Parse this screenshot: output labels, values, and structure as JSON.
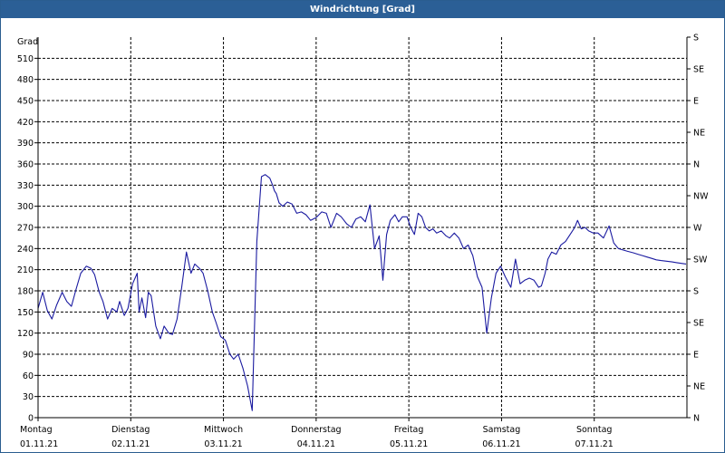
{
  "window": {
    "title": "Windrichtung [Grad]"
  },
  "colors": {
    "title_bar": "#2b5f96",
    "line": "#1a1aa0",
    "grid": "#000000",
    "axis": "#000000"
  },
  "chart_data": {
    "type": "line",
    "title": "Windrichtung [Grad]",
    "ylabel": "Grad",
    "ylim": [
      0,
      540
    ],
    "y_ticks": [
      0,
      30,
      60,
      90,
      120,
      150,
      180,
      210,
      240,
      270,
      300,
      330,
      360,
      390,
      420,
      450,
      480,
      510
    ],
    "right_axis_labels": [
      "N",
      "NE",
      "E",
      "SE",
      "S",
      "SW",
      "W",
      "NW",
      "N",
      "NE",
      "E",
      "SE",
      "S"
    ],
    "x_unit": "days since 01.11.21 00:00",
    "xlim": [
      0,
      7
    ],
    "x_ticks": [
      {
        "day": "Montag",
        "date": "01.11.21"
      },
      {
        "day": "Dienstag",
        "date": "02.11.21"
      },
      {
        "day": "Mittwoch",
        "date": "03.11.21"
      },
      {
        "day": "Donnerstag",
        "date": "04.11.21"
      },
      {
        "day": "Freitag",
        "date": "05.11.21"
      },
      {
        "day": "Samstag",
        "date": "06.11.21"
      },
      {
        "day": "Sonntag",
        "date": "07.11.21"
      }
    ],
    "grid": true,
    "series": [
      {
        "name": "",
        "x": [
          0.0,
          0.05,
          0.1,
          0.15,
          0.2,
          0.26,
          0.31,
          0.36,
          0.41,
          0.46,
          0.52,
          0.57,
          0.61,
          0.66,
          0.7,
          0.75,
          0.8,
          0.85,
          0.88,
          0.93,
          0.97,
          1.02,
          1.07,
          1.09,
          1.12,
          1.16,
          1.19,
          1.22,
          1.27,
          1.32,
          1.36,
          1.41,
          1.45,
          1.5,
          1.55,
          1.6,
          1.65,
          1.69,
          1.74,
          1.78,
          1.83,
          1.88,
          1.92,
          1.97,
          2.02,
          2.07,
          2.11,
          2.16,
          2.21,
          2.26,
          2.31,
          2.36,
          2.41,
          2.45,
          2.5,
          2.53,
          2.55,
          2.57,
          2.6,
          2.64,
          2.69,
          2.74,
          2.79,
          2.84,
          2.89,
          2.94,
          3.0,
          3.06,
          3.11,
          3.16,
          3.22,
          3.27,
          3.33,
          3.38,
          3.43,
          3.48,
          3.53,
          3.58,
          3.63,
          3.68,
          3.72,
          3.76,
          3.8,
          3.85,
          3.89,
          3.93,
          3.98,
          4.02,
          4.06,
          4.1,
          4.14,
          4.18,
          4.22,
          4.26,
          4.3,
          4.35,
          4.4,
          4.44,
          4.49,
          4.54,
          4.59,
          4.64,
          4.69,
          4.74,
          4.79,
          4.84,
          4.89,
          4.94,
          4.99,
          5.04,
          5.1,
          5.15,
          5.2,
          5.25,
          5.3,
          5.35,
          5.4,
          5.43,
          5.47,
          5.5,
          5.54,
          5.59,
          5.64,
          5.69,
          5.74,
          5.79,
          5.82,
          5.86,
          5.9,
          5.94,
          5.99,
          6.04,
          6.1,
          6.16,
          6.21,
          6.26,
          6.31,
          6.36,
          6.42,
          6.47,
          6.52,
          6.57,
          6.62,
          6.67,
          6.72,
          6.78,
          6.84,
          6.89,
          6.94,
          6.99
        ],
        "y": [
          155,
          178,
          152,
          140,
          160,
          178,
          165,
          158,
          182,
          205,
          215,
          212,
          203,
          178,
          165,
          140,
          155,
          150,
          165,
          145,
          155,
          190,
          205,
          150,
          170,
          142,
          178,
          173,
          130,
          112,
          130,
          120,
          118,
          140,
          185,
          235,
          205,
          218,
          212,
          205,
          180,
          150,
          135,
          115,
          110,
          90,
          83,
          90,
          70,
          45,
          10,
          250,
          342,
          345,
          340,
          330,
          322,
          318,
          305,
          300,
          306,
          303,
          290,
          292,
          288,
          280,
          284,
          292,
          290,
          270,
          290,
          285,
          275,
          270,
          282,
          285,
          278,
          302,
          240,
          258,
          195,
          260,
          280,
          288,
          278,
          285,
          285,
          270,
          260,
          290,
          285,
          270,
          265,
          268,
          262,
          265,
          258,
          255,
          262,
          255,
          240,
          245,
          230,
          200,
          185,
          120,
          170,
          205,
          215,
          200,
          185,
          225,
          190,
          195,
          198,
          195,
          185,
          187,
          205,
          225,
          235,
          232,
          245,
          250,
          260,
          270,
          280,
          268,
          270,
          265,
          262,
          262,
          255,
          272,
          248,
          240,
          238,
          236,
          234,
          232,
          230,
          228,
          226,
          224,
          223,
          222,
          221,
          220,
          219,
          218
        ]
      }
    ]
  }
}
